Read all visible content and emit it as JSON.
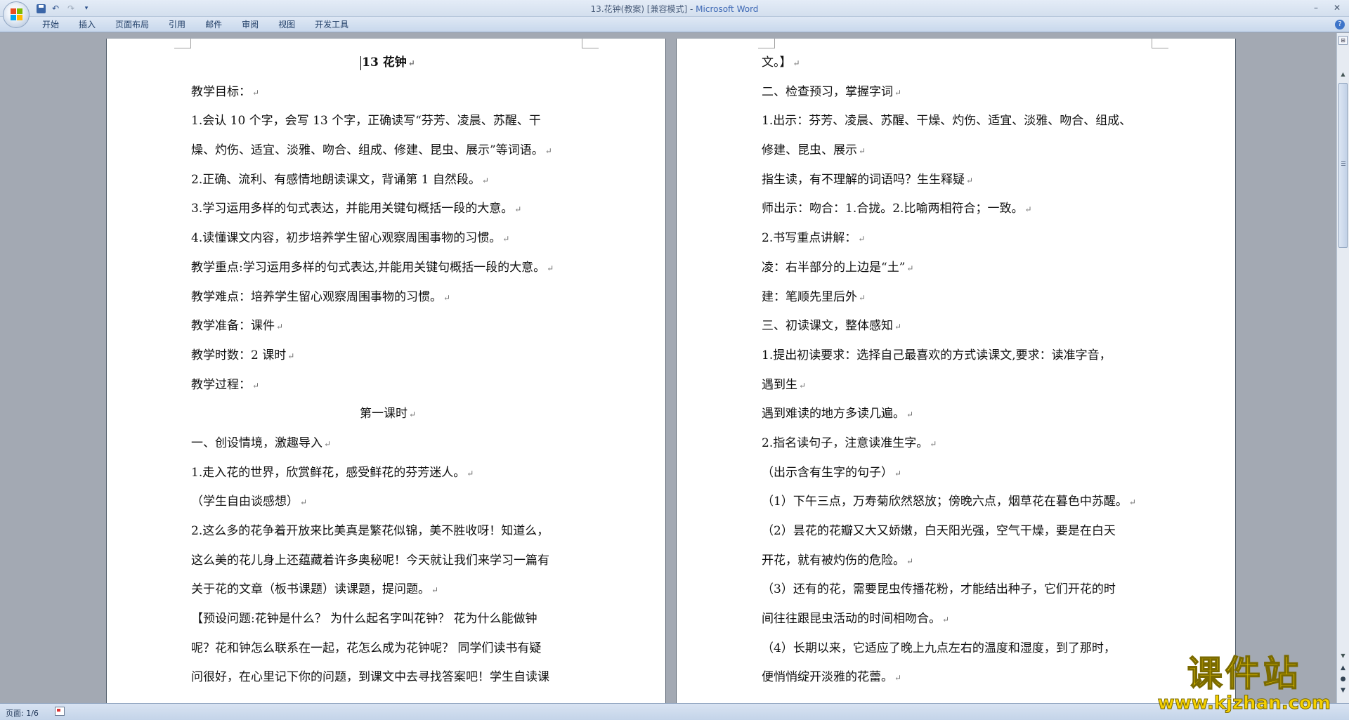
{
  "window": {
    "doc_name": "13.花钟(教案) [兼容模式]",
    "separator": " - ",
    "app_name": "Microsoft Word"
  },
  "ribbon": {
    "tabs": [
      "开始",
      "插入",
      "页面布局",
      "引用",
      "邮件",
      "审阅",
      "视图",
      "开发工具"
    ]
  },
  "page_left": {
    "title": "13 花钟",
    "lines": [
      "教学目标：",
      "1.会认 10 个字，会写 13 个字，正确读写“芬芳、凌晨、苏醒、干",
      "燥、灼伤、适宜、淡雅、吻合、组成、修建、昆虫、展示”等词语。",
      "2.正确、流利、有感情地朗读课文，背诵第 1 自然段。",
      "3.学习运用多样的句式表达，并能用关键句概括一段的大意。",
      "4.读懂课文内容，初步培养学生留心观察周围事物的习惯。",
      "教学重点:学习运用多样的句式表达,并能用关键句概括一段的大意。",
      "教学难点：培养学生留心观察周围事物的习惯。",
      "教学准备：课件",
      "教学时数：2 课时",
      "教学过程：",
      "第一课时",
      "一、创设情境，激趣导入",
      "1.走入花的世界，欣赏鲜花，感受鲜花的芬芳迷人。",
      "（学生自由谈感想）",
      "2.这么多的花争着开放来比美真是繁花似锦，美不胜收呀！知道么，",
      "这么美的花儿身上还蕴藏着许多奥秘呢！今天就让我们来学习一篇有",
      "关于花的文章（板书课题）读课题，提问题。",
      "【预设问题:花钟是什么？ 为什么起名字叫花钟？ 花为什么能做钟",
      "呢？花和钟怎么联系在一起，花怎么成为花钟呢？ 同学们读书有疑",
      "问很好，在心里记下你的问题，到课文中去寻找答案吧！学生自读课"
    ]
  },
  "page_right": {
    "lines": [
      "文。】",
      "二、检查预习，掌握字词",
      "1.出示：芬芳、凌晨、苏醒、干燥、灼伤、适宜、淡雅、吻合、组成、",
      "修建、昆虫、展示",
      "指生读，有不理解的词语吗？生生释疑",
      "师出示：吻合：1.合拢。2.比喻两相符合；一致。",
      "2.书写重点讲解：",
      "凌：右半部分的上边是“土”",
      "建：笔顺先里后外",
      "三、初读课文，整体感知",
      "1.提出初读要求：选择自己最喜欢的方式读课文,要求：读准字音，",
      "遇到生",
      "遇到难读的地方多读几遍。",
      "2.指名读句子，注意读准生字。",
      "（出示含有生字的句子）",
      "（1）下午三点，万寿菊欣然怒放；傍晚六点，烟草花在暮色中苏醒。",
      "（2）昙花的花瓣又大又娇嫩，白天阳光强，空气干燥，要是在白天",
      "开花，就有被灼伤的危险。",
      "（3）还有的花，需要昆虫传播花粉，才能结出种子，它们开花的时",
      "间往往跟昆虫活动的时间相吻合。",
      "（4）长期以来，它适应了晚上九点左右的温度和湿度，到了那时，",
      "便悄悄绽开淡雅的花蕾。"
    ]
  },
  "status": {
    "page_label": "页面: 1/6"
  },
  "watermark": {
    "title": "课件站",
    "url": "www.kjzhan.com"
  },
  "icons": [
    "office-button-icon",
    "save-icon",
    "undo-icon",
    "redo-icon",
    "customize-icon",
    "minimize-icon",
    "close-icon",
    "help-icon",
    "paragraph-mark-icon",
    "view-ruler-icon",
    "scroll-up-icon",
    "scroll-down-icon",
    "previous-page-icon",
    "browse-object-icon",
    "next-page-icon",
    "proofing-icon"
  ]
}
